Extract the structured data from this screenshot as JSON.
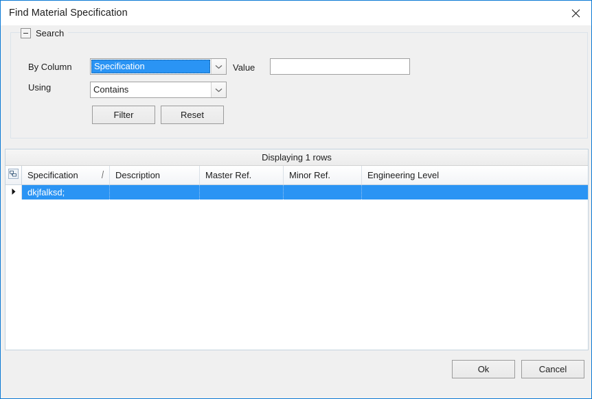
{
  "window": {
    "title": "Find Material Specification",
    "close_icon": "close-x-icon",
    "accent_color": "#0a78d4",
    "body_color": "#f0f0f0"
  },
  "search_group": {
    "title": "Search",
    "expander_icon": "minus-collapse-icon",
    "fields": {
      "by_column_label": "By Column",
      "by_column_value": "Specification",
      "using_label": "Using",
      "using_value": "Contains",
      "value_label": "Value",
      "value_text": "",
      "value_placeholder": ""
    },
    "buttons": {
      "filter": "Filter",
      "reset": "Reset"
    },
    "selection_color": "#2a94f4"
  },
  "grid": {
    "caption": "Displaying 1 rows",
    "corner_icon": "select-all-grid-icon",
    "row_indicator_icon": "current-row-arrow-icon",
    "sort_indicator": "↑",
    "sorted_column": "Specification",
    "columns": [
      "Specification",
      "Description",
      "Master Ref.",
      "Minor Ref.",
      "Engineering Level"
    ],
    "rows": [
      {
        "selected": true,
        "cells": [
          "dkjfalksd;",
          "",
          "",
          "",
          ""
        ]
      }
    ]
  },
  "footer": {
    "ok": "Ok",
    "cancel": "Cancel"
  }
}
